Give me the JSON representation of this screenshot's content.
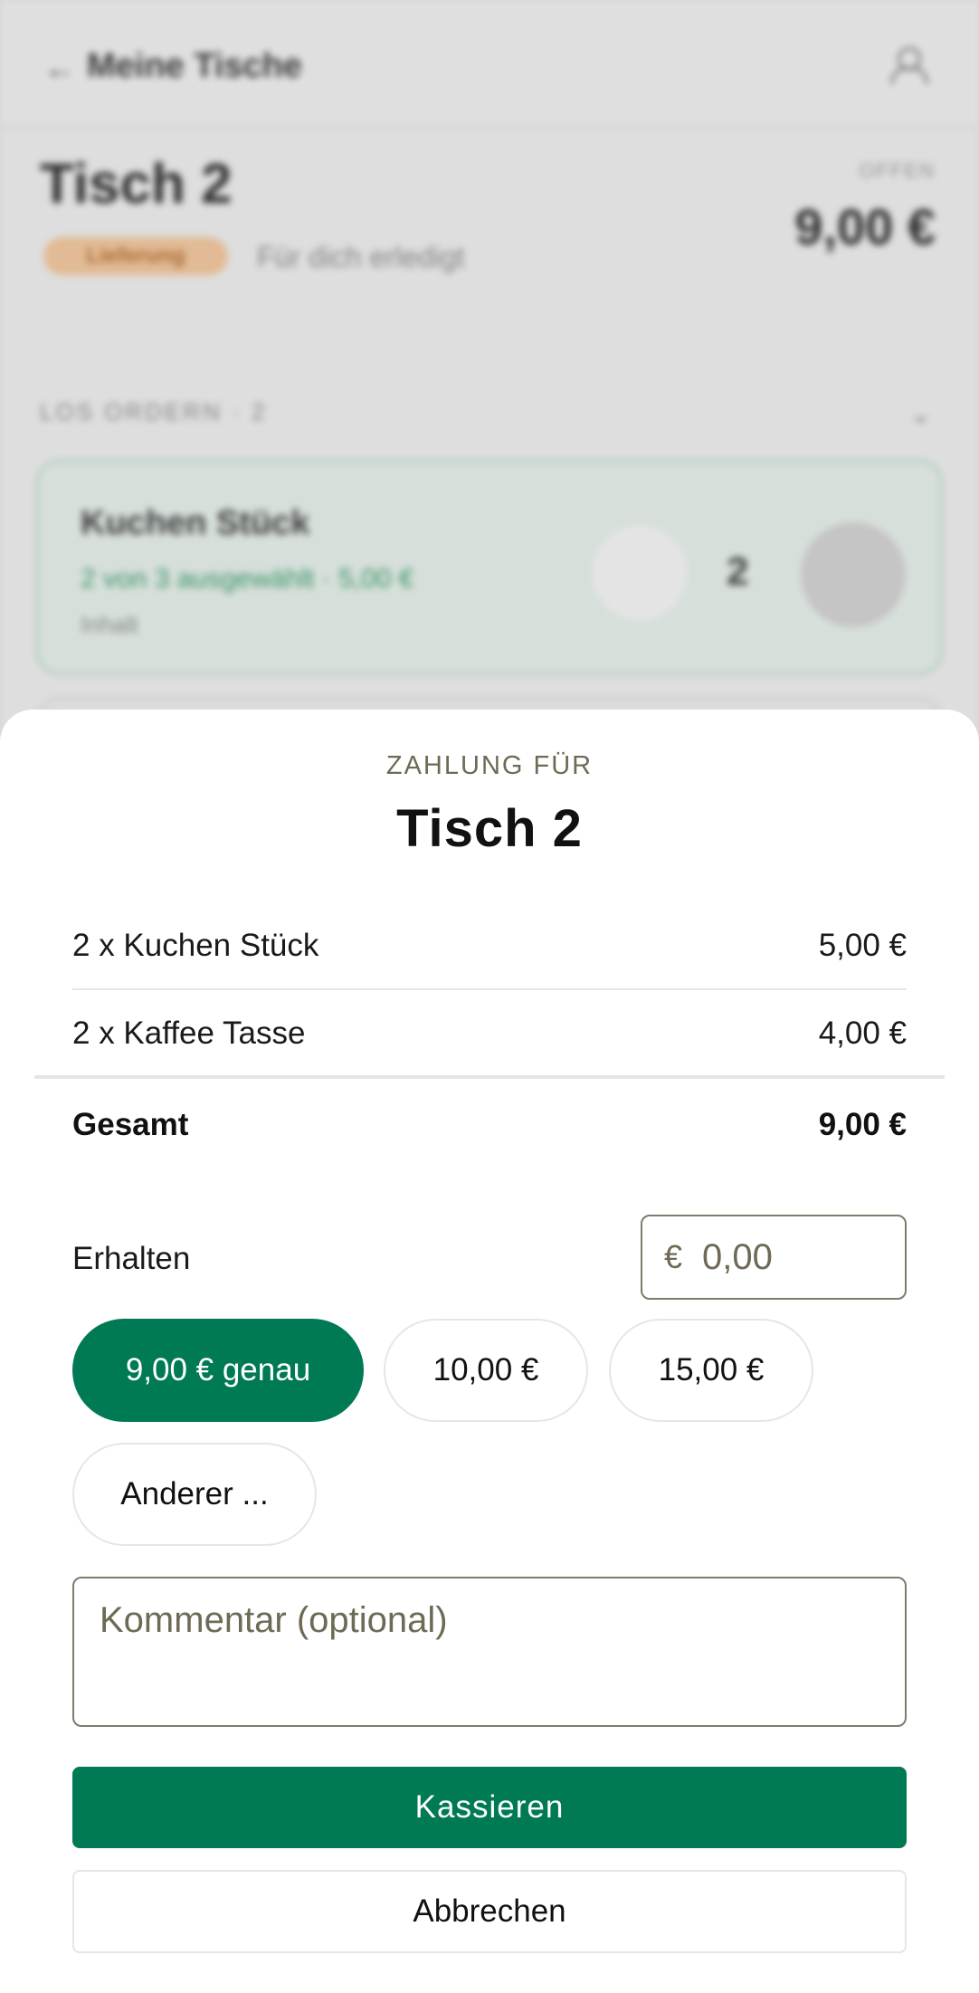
{
  "background": {
    "header_title": "Meine Tische",
    "table_title": "Tisch 2",
    "status_badge": "Lieferung",
    "status_text": "Für dich erledigt",
    "total_label": "OFFEN",
    "total_value": "9,00 €",
    "section_label": "LOS ORDERN",
    "section_count": "2",
    "card": {
      "name": "Kuchen Stück",
      "sub": "2 von 3 ausgewählt · 5,00 €",
      "note": "Inhalt",
      "quantity": "2"
    }
  },
  "sheet": {
    "eyebrow": "ZAHLUNG FÜR",
    "title": "Tisch 2",
    "items": [
      {
        "label": "2 x Kuchen Stück",
        "price": "5,00 €"
      },
      {
        "label": "2 x Kaffee Tasse",
        "price": "4,00 €"
      }
    ],
    "total_label": "Gesamt",
    "total_value": "9,00 €",
    "received_label": "Erhalten",
    "currency_symbol": "€",
    "received_placeholder": "0,00",
    "chips": [
      {
        "label": "9,00 € genau",
        "active": true
      },
      {
        "label": "10,00 €",
        "active": false
      },
      {
        "label": "15,00 €",
        "active": false
      },
      {
        "label": "Anderer ...",
        "active": false
      }
    ],
    "comment_placeholder": "Kommentar (optional)",
    "primary_button": "Kassieren",
    "secondary_button": "Abbrechen"
  },
  "colors": {
    "accent": "#007a55",
    "muted_text": "#6e6a55",
    "divider": "#e6e6e6"
  }
}
